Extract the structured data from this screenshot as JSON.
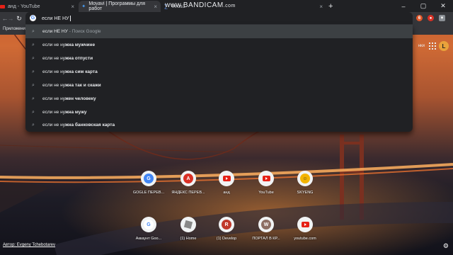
{
  "tabs": [
    {
      "title": "анд - YouTube",
      "close": "×",
      "fav_icon": "youtube-favicon"
    },
    {
      "title": "Movavi | Программы для работ",
      "close": "×",
      "fav_icon": "movavi-favicon"
    },
    {
      "title": "Virus1",
      "close": "×",
      "fav_icon": "virustotal-favicon"
    }
  ],
  "new_tab": "+",
  "watermark": {
    "main": "www.BANDICAM",
    "suffix": ".com"
  },
  "window_controls": {
    "minimize": "–",
    "maximize": "▢",
    "close": "✕"
  },
  "toolbar": {
    "back": "←",
    "forward": "→",
    "reload": "↻"
  },
  "omnibox": {
    "value": "если НЕ НУ"
  },
  "bookmarks": {
    "label": "Приложения"
  },
  "suggestions": [
    {
      "typed": "если НЕ НУ",
      "completion": "",
      "hint": "- Поиск Google"
    },
    {
      "typed": "если не ну",
      "completion": "жна мужчине",
      "hint": ""
    },
    {
      "typed": "если не ну",
      "completion": "жна отпусти",
      "hint": ""
    },
    {
      "typed": "если не ну",
      "completion": "жна сим карта",
      "hint": ""
    },
    {
      "typed": "если не ну",
      "completion": "жна так и скажи",
      "hint": ""
    },
    {
      "typed": "если не ну",
      "completion": "жен человеку",
      "hint": ""
    },
    {
      "typed": "если не ну",
      "completion": "жна мужу",
      "hint": ""
    },
    {
      "typed": "если не ну",
      "completion": "жна банковская карта",
      "hint": ""
    }
  ],
  "page": {
    "nav_right": "нки",
    "avatar_letter": "L"
  },
  "shortcuts_row1": [
    {
      "label": "GOGLE ПЕРЕВ...",
      "icon": "google-translate-icon"
    },
    {
      "label": "ЯНДЕКС ПЕРЕВ...",
      "icon": "yandex-translate-icon"
    },
    {
      "label": "анд",
      "icon": "youtube-icon"
    },
    {
      "label": "YouTube",
      "icon": "youtube-icon"
    },
    {
      "label": "SKYENG",
      "icon": "skyeng-icon"
    }
  ],
  "shortcuts_row2": [
    {
      "label": "Аккаунт Goo...",
      "icon": "google-icon",
      "letter": "G"
    },
    {
      "label": "(1) Home",
      "icon": "roblox-icon",
      "letter": ""
    },
    {
      "label": "(1) Develop",
      "icon": "letter-r-icon",
      "letter": "R"
    },
    {
      "label": "ПОРТАЛ В КР...",
      "icon": "letter-w-icon",
      "letter": "W"
    },
    {
      "label": "youtube.com",
      "icon": "youtube-icon",
      "letter": ""
    }
  ],
  "footer": {
    "author": "Автор: Evgeny Tchebotarev",
    "settings_icon": "gear-icon"
  },
  "colors": {
    "tab_bar": "#202124",
    "toolbar": "#35363a",
    "dropdown": "#202124",
    "selected": "#3c4043"
  }
}
